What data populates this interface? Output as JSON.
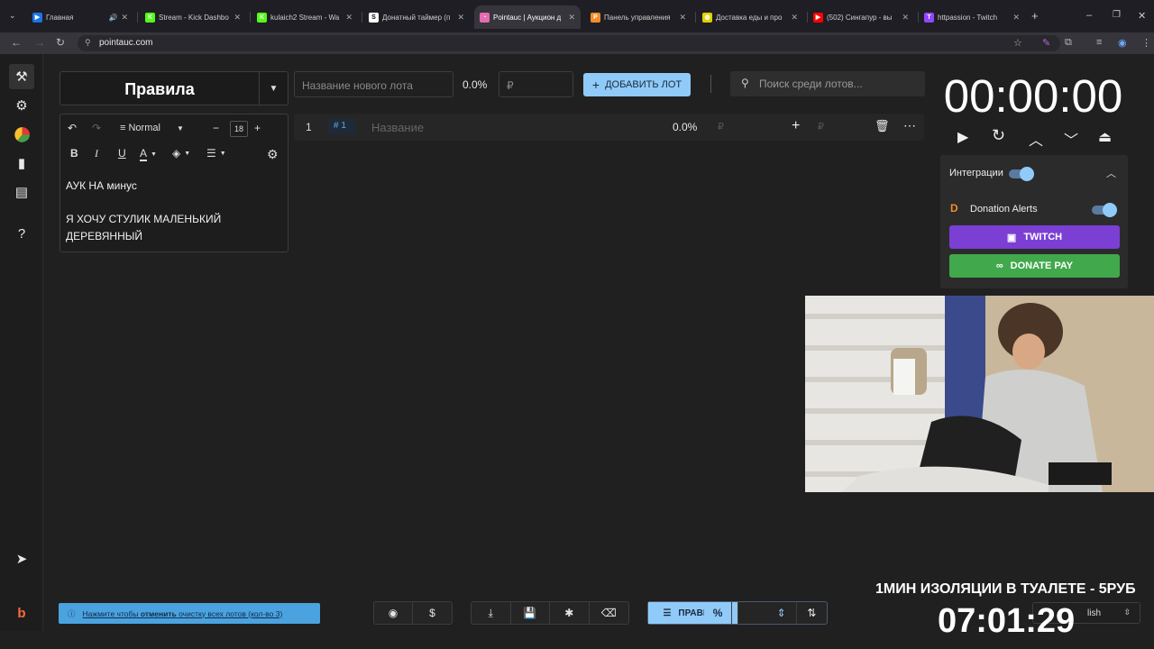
{
  "browser": {
    "tabs": [
      {
        "title": "Главная",
        "color": "#1a73e8",
        "glyph": "▶"
      },
      {
        "title": "Stream - Kick Dashbo",
        "color": "#53fc18",
        "glyph": "K"
      },
      {
        "title": "kulaich2 Stream - Wa",
        "color": "#53fc18",
        "glyph": "K"
      },
      {
        "title": "Донатный таймер (п",
        "color": "#ffffff",
        "glyph": "S"
      },
      {
        "title": "Pointauc | Аукцион д",
        "color": "#e36bb0",
        "glyph": "◔"
      },
      {
        "title": "Панель управления",
        "color": "#f28c28",
        "glyph": "P"
      },
      {
        "title": "Доставка еды и про",
        "color": "#e0d000",
        "glyph": "◍"
      },
      {
        "title": "(502) Сингапур - вы",
        "color": "#ff0000",
        "glyph": "▶"
      },
      {
        "title": "httpassion - Twitch",
        "color": "#9146ff",
        "glyph": "T"
      }
    ],
    "url": "pointauc.com"
  },
  "rules": {
    "title": "Правила",
    "font_style": "Normal",
    "font_size": "18",
    "lines": [
      "АУК НА минус",
      "",
      "Я ХОЧУ СТУЛИК МАЛЕНЬКИЙ ДЕРЕВЯННЫЙ"
    ]
  },
  "lot_form": {
    "name_placeholder": "Название нового лота",
    "percent": "0.0%",
    "amount_placeholder": "₽",
    "add_button": "ДОБАВИТЬ ЛОТ",
    "search_placeholder": "Поиск среди лотов..."
  },
  "lot_row": {
    "index": "1",
    "id": "# 1",
    "name_placeholder": "Название",
    "percent": "0.0%",
    "currency": "₽",
    "add_currency": "₽"
  },
  "timer": {
    "value": "00:00:00"
  },
  "integrations": {
    "title": "Интеграции",
    "donation_alerts": "Donation Alerts",
    "twitch": "TWITCH",
    "donate_pay": "DONATE PAY"
  },
  "overlay": {
    "promo": "1МИН ИЗОЛЯЦИИ В ТУАЛЕТЕ - 5РУБ",
    "countdown": "07:01:29"
  },
  "bottom": {
    "notice_prefix": "Нажмите чтобы",
    "notice_bold": "отменить",
    "notice_suffix": "очистку всех лотов (кол-во 3)",
    "rules_button": "ПРАВИЛА",
    "language": "lish"
  }
}
